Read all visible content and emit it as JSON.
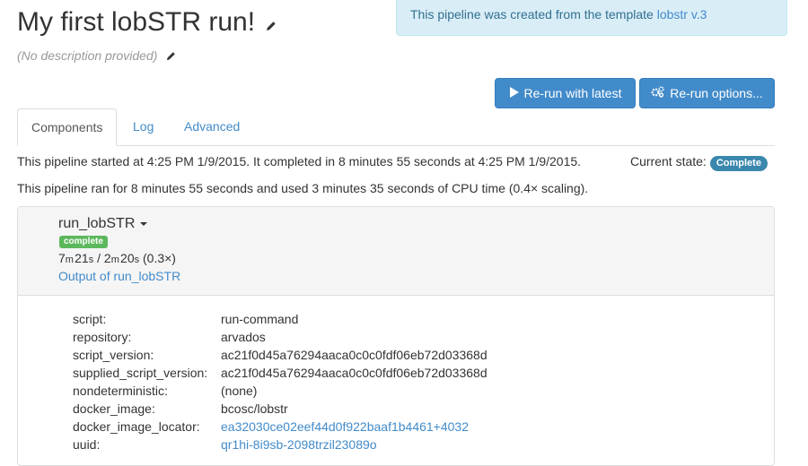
{
  "header": {
    "title": "My first lobSTR run!",
    "description": "(No description provided)"
  },
  "info_box": {
    "text": "This pipeline was created from the template ",
    "link": "lobstr v.3"
  },
  "buttons": {
    "rerun_latest": "Re-run with latest",
    "rerun_options": "Re-run options..."
  },
  "tabs": [
    {
      "label": "Components",
      "active": true
    },
    {
      "label": "Log",
      "active": false
    },
    {
      "label": "Advanced",
      "active": false
    }
  ],
  "summary": {
    "line1": "This pipeline started at 4:25 PM 1/9/2015. It completed in 8 minutes 55 seconds at 4:25 PM 1/9/2015.",
    "state_label": "Current state:",
    "state_value": "Complete",
    "line2": "This pipeline ran for 8 minutes 55 seconds and used 3 minutes 35 seconds of CPU time (0.4× scaling)."
  },
  "component": {
    "name": "run_lobSTR",
    "status": "complete",
    "runtime": {
      "m1": "7",
      "s1": "21",
      "m2": "2",
      "s2": "20",
      "scaling": "(0.3×)"
    },
    "output_link": "Output of run_lobSTR",
    "properties": [
      {
        "key": "script:",
        "value": "run-command",
        "link": false
      },
      {
        "key": "repository:",
        "value": "arvados",
        "link": false
      },
      {
        "key": "script_version:",
        "value": "ac21f0d45a76294aaca0c0c0fdf06eb72d03368d",
        "link": false
      },
      {
        "key": "supplied_script_version:",
        "value": "ac21f0d45a76294aaca0c0c0fdf06eb72d03368d",
        "link": false
      },
      {
        "key": "nondeterministic:",
        "value": "(none)",
        "link": false
      },
      {
        "key": "docker_image:",
        "value": "bcosc/lobstr",
        "link": false
      },
      {
        "key": "docker_image_locator:",
        "value": "ea32030ce02eef44d0f922baaf1b4461+4032",
        "link": true
      },
      {
        "key": "uuid:",
        "value": "qr1hi-8i9sb-2098trzil23089o",
        "link": true
      }
    ]
  },
  "colors": {
    "primary": "#428bca",
    "info_bg": "#d9edf7",
    "success": "#5cb85c",
    "state_badge": "#3a87ad"
  }
}
